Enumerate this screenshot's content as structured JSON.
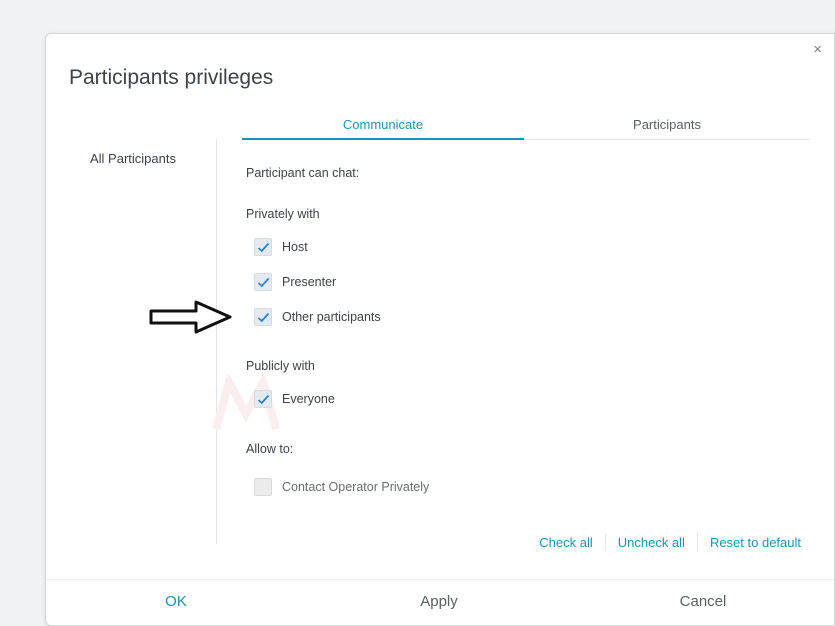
{
  "dialog": {
    "title": "Participants privileges",
    "close_glyph": "×"
  },
  "tabs": [
    {
      "label": "Communicate",
      "active": true
    },
    {
      "label": "Participants",
      "active": false
    }
  ],
  "sidebar": {
    "items": [
      {
        "label": "All Participants"
      }
    ]
  },
  "communicate": {
    "intro": "Participant can chat:",
    "privately_heading": "Privately with",
    "privately_options": [
      {
        "label": "Host",
        "checked": true
      },
      {
        "label": "Presenter",
        "checked": true
      },
      {
        "label": "Other participants",
        "checked": true
      }
    ],
    "publicly_heading": "Publicly with",
    "publicly_options": [
      {
        "label": "Everyone",
        "checked": true
      }
    ],
    "allow_heading": "Allow to:",
    "allow_options": [
      {
        "label": "Contact Operator Privately",
        "checked": false,
        "disabled": true
      }
    ]
  },
  "actions": {
    "check_all": "Check all",
    "uncheck_all": "Uncheck all",
    "reset_default": "Reset to default"
  },
  "footer": {
    "ok": "OK",
    "apply": "Apply",
    "cancel": "Cancel"
  },
  "colors": {
    "accent": "#1e94b3",
    "checkmark": "#2a86c9",
    "text": "#3f4349"
  }
}
